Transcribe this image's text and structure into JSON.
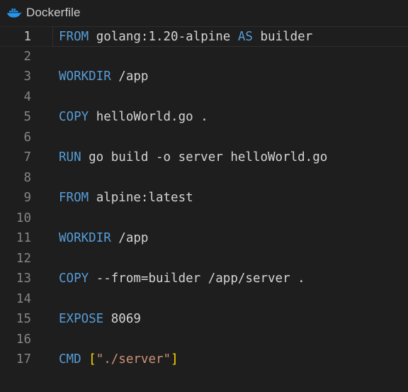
{
  "tab": {
    "icon": "docker-whale-icon",
    "label": "Dockerfile"
  },
  "colors": {
    "background": "#1e1e1e",
    "keyword": "#569cd6",
    "text": "#d4d4d4",
    "string": "#ce9178",
    "bracket": "#ffd700",
    "line_number": "#858585",
    "docker_icon": "#2496ed"
  },
  "editor": {
    "current_line": 1,
    "lines": [
      {
        "number": "1",
        "tokens": [
          {
            "t": "FROM",
            "c": "kw"
          },
          {
            "t": " golang:1.20-alpine ",
            "c": "plain"
          },
          {
            "t": "AS",
            "c": "kw"
          },
          {
            "t": " builder",
            "c": "plain"
          }
        ]
      },
      {
        "number": "2",
        "tokens": []
      },
      {
        "number": "3",
        "tokens": [
          {
            "t": "WORKDIR",
            "c": "kw"
          },
          {
            "t": " /app",
            "c": "plain"
          }
        ]
      },
      {
        "number": "4",
        "tokens": []
      },
      {
        "number": "5",
        "tokens": [
          {
            "t": "COPY",
            "c": "kw"
          },
          {
            "t": " helloWorld.go .",
            "c": "plain"
          }
        ]
      },
      {
        "number": "6",
        "tokens": []
      },
      {
        "number": "7",
        "tokens": [
          {
            "t": "RUN",
            "c": "kw"
          },
          {
            "t": " go build -o server helloWorld.go",
            "c": "plain"
          }
        ]
      },
      {
        "number": "8",
        "tokens": []
      },
      {
        "number": "9",
        "tokens": [
          {
            "t": "FROM",
            "c": "kw"
          },
          {
            "t": " alpine:latest",
            "c": "plain"
          }
        ]
      },
      {
        "number": "10",
        "tokens": []
      },
      {
        "number": "11",
        "tokens": [
          {
            "t": "WORKDIR",
            "c": "kw"
          },
          {
            "t": " /app",
            "c": "plain"
          }
        ]
      },
      {
        "number": "12",
        "tokens": []
      },
      {
        "number": "13",
        "tokens": [
          {
            "t": "COPY",
            "c": "kw"
          },
          {
            "t": " --from=builder /app/server .",
            "c": "plain"
          }
        ]
      },
      {
        "number": "14",
        "tokens": []
      },
      {
        "number": "15",
        "tokens": [
          {
            "t": "EXPOSE",
            "c": "kw"
          },
          {
            "t": " 8069",
            "c": "plain"
          }
        ]
      },
      {
        "number": "16",
        "tokens": []
      },
      {
        "number": "17",
        "tokens": [
          {
            "t": "CMD",
            "c": "kw"
          },
          {
            "t": " ",
            "c": "plain"
          },
          {
            "t": "[",
            "c": "brk"
          },
          {
            "t": "\"./server\"",
            "c": "str"
          },
          {
            "t": "]",
            "c": "brk"
          }
        ]
      }
    ]
  }
}
